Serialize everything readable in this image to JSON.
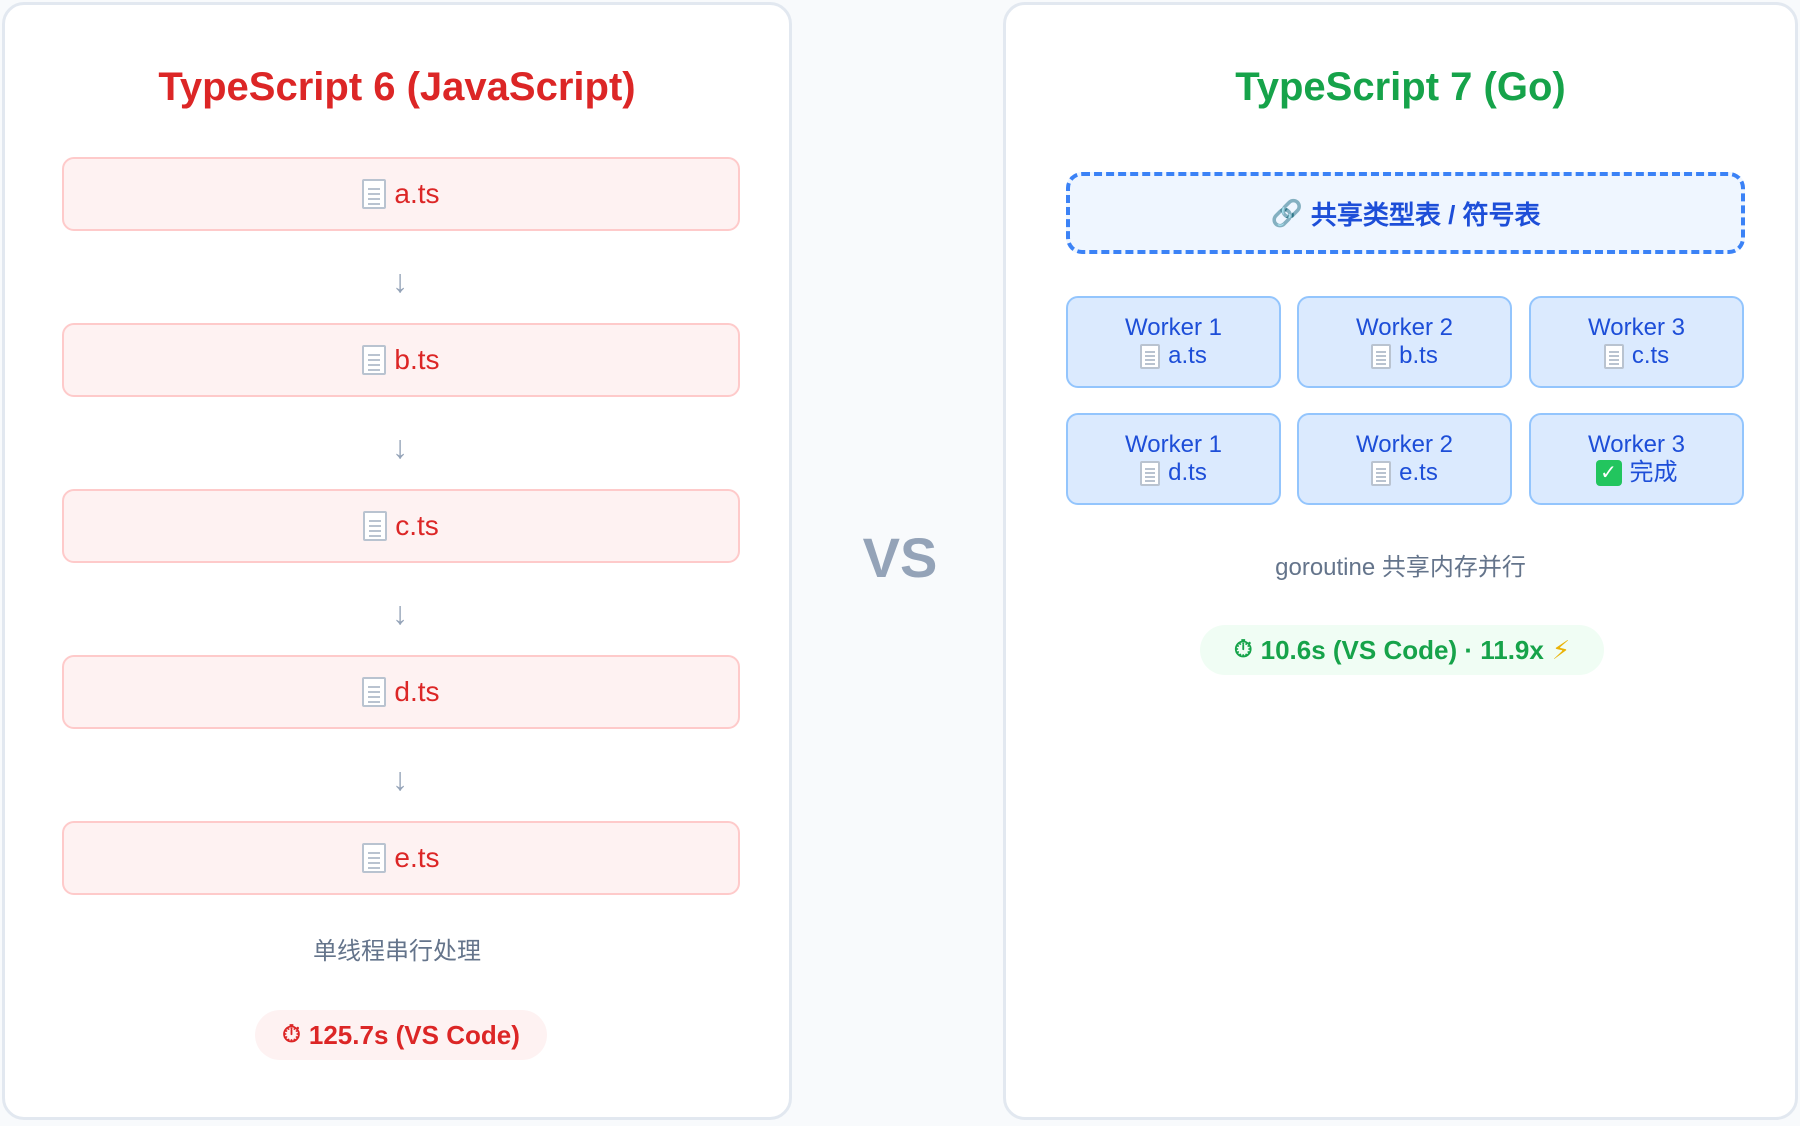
{
  "left": {
    "title": "TypeScript 6 (JavaScript)",
    "files": [
      "a.ts",
      "b.ts",
      "c.ts",
      "d.ts",
      "e.ts"
    ],
    "arrow": "↓",
    "caption": "单线程串行处理",
    "timer_icon": "⏱",
    "timing": "125.7s (VS Code)"
  },
  "vs_label": "VS",
  "right": {
    "title": "TypeScript 7 (Go)",
    "shared_icon": "🔗",
    "shared_label": "共享类型表 / 符号表",
    "workers": [
      {
        "name": "Worker 1",
        "file": "a.ts",
        "icon": "file-icon"
      },
      {
        "name": "Worker 2",
        "file": "b.ts",
        "icon": "file-icon"
      },
      {
        "name": "Worker 3",
        "file": "c.ts",
        "icon": "file-icon"
      },
      {
        "name": "Worker 1",
        "file": "d.ts",
        "icon": "file-icon"
      },
      {
        "name": "Worker 2",
        "file": "e.ts",
        "icon": "file-icon"
      },
      {
        "name": "Worker 3",
        "file": "完成",
        "icon": "check-icon"
      }
    ],
    "check_glyph": "✓",
    "caption": "goroutine 共享内存并行",
    "timer_icon": "⏱",
    "timing": "10.6s (VS Code) · 11.9x",
    "bolt_icon": "⚡"
  }
}
